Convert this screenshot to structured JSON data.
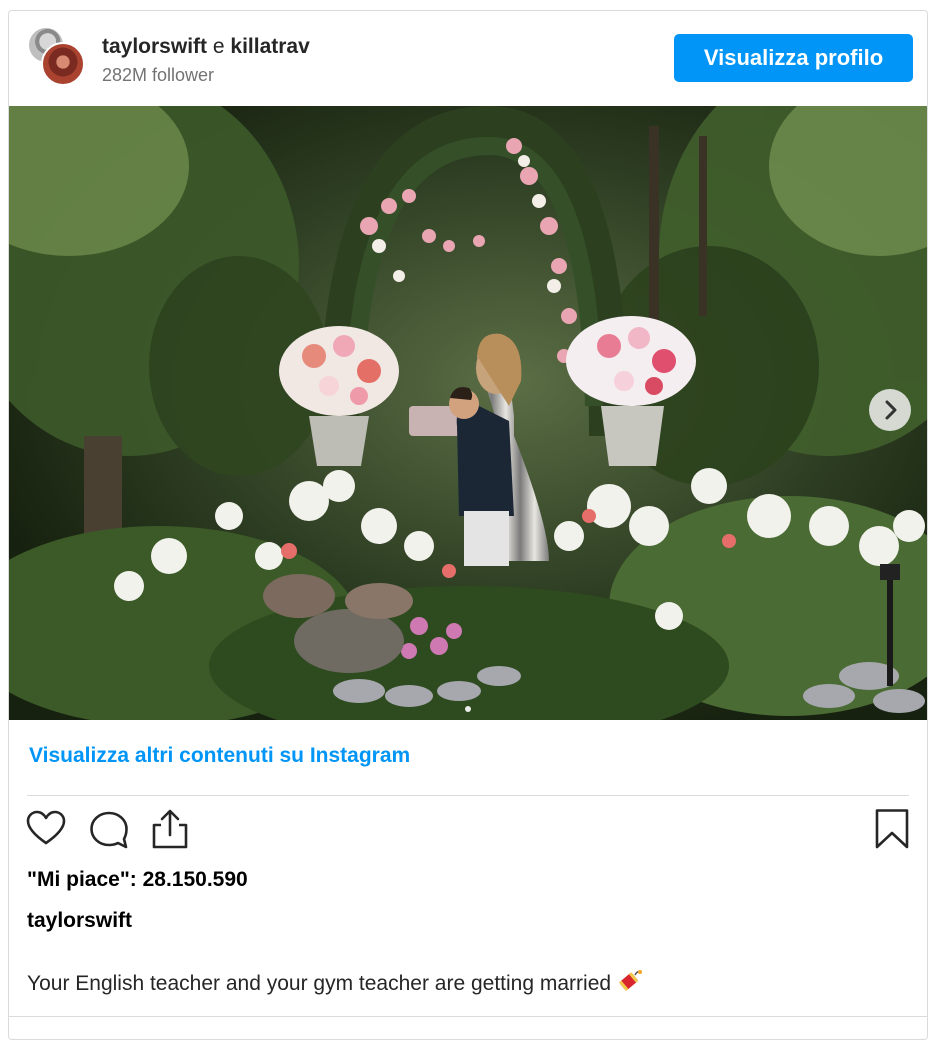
{
  "post": {
    "author_primary": "taylorswift",
    "conjunction": "e",
    "author_secondary": "killatrav",
    "followers": "282M follower",
    "profile_button": "Visualizza profilo",
    "more_link": "Visualizza altri contenuti su Instagram",
    "likes": "\"Mi piace\": 28.150.590",
    "caption_author": "taylorswift",
    "caption": "Your English teacher and your gym teacher are getting married",
    "image_alt": "Couple kissing in a garden surrounded by flower arches",
    "carousel": {
      "current": 1,
      "total": 1
    }
  },
  "icons": {
    "like": "heart-icon",
    "comment": "comment-bubble-icon",
    "share": "share-icon",
    "save": "bookmark-icon",
    "next": "chevron-right-icon",
    "emoji": "firecracker-emoji-icon"
  },
  "colors": {
    "accent": "#0095f6",
    "text_primary": "#262626",
    "text_secondary": "#737373",
    "border": "#dbdbdb"
  }
}
